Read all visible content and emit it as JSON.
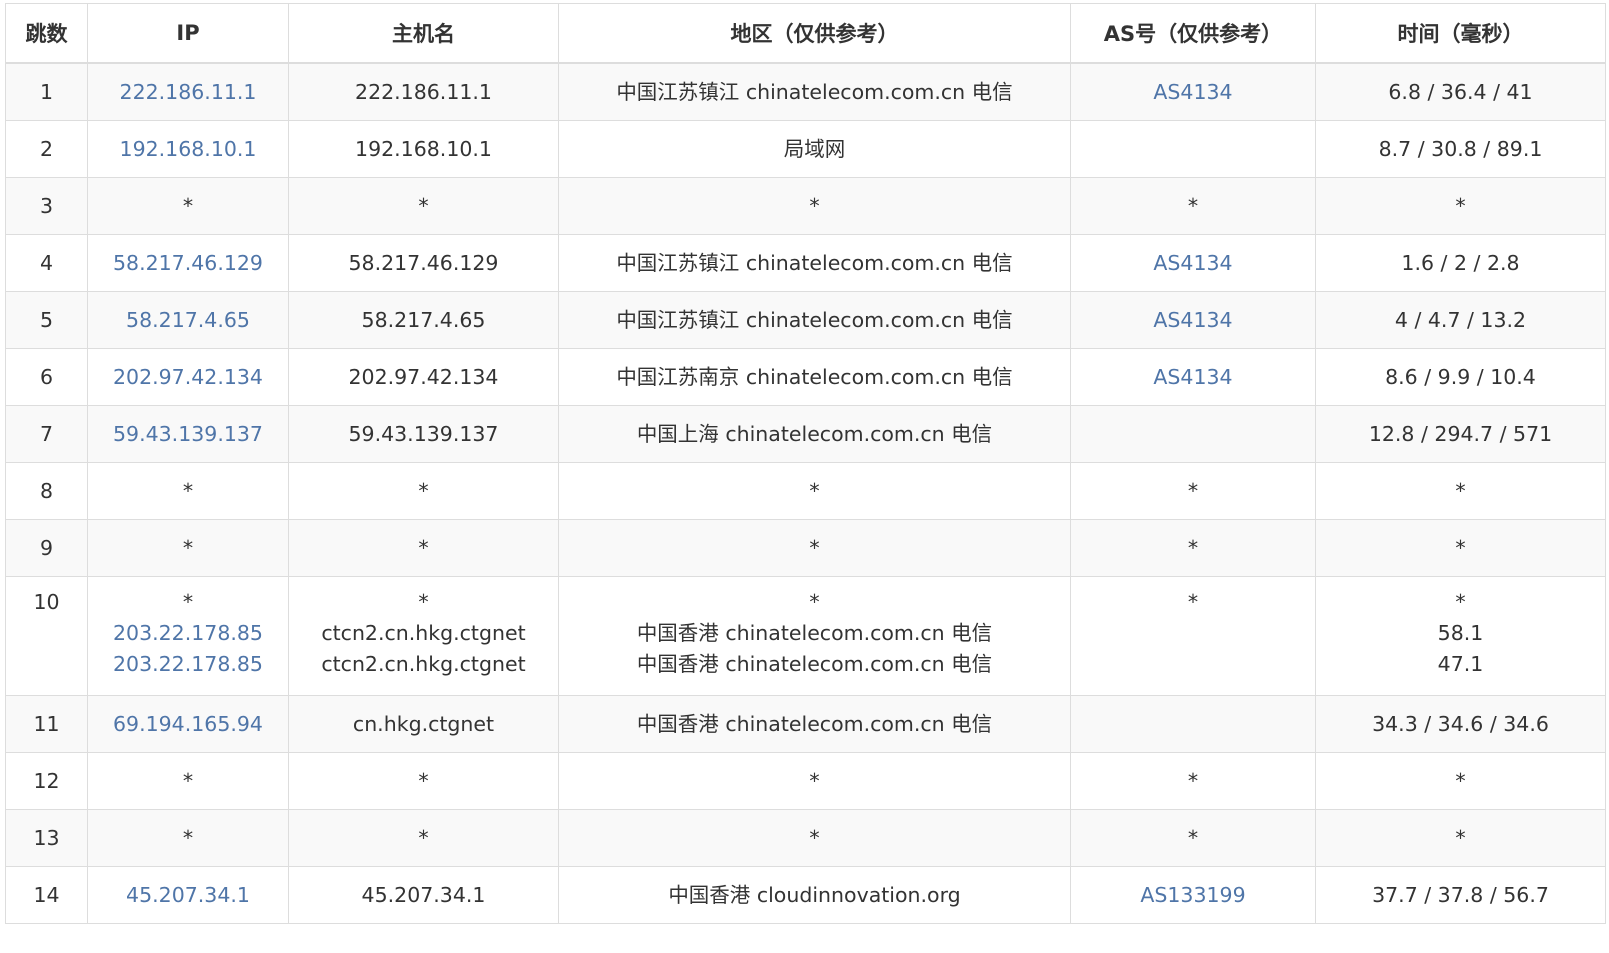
{
  "columns": [
    "跳数",
    "IP",
    "主机名",
    "地区（仅供参考）",
    "AS号（仅供参考）",
    "时间（毫秒）"
  ],
  "colors": {
    "link": "#4f75a8",
    "text": "#333333",
    "row_stripe": "#f9f9f9",
    "border": "#dddddd"
  },
  "rows": [
    {
      "hop": "1",
      "ip": [
        "222.186.11.1"
      ],
      "host": [
        "222.186.11.1"
      ],
      "region": [
        "中国江苏镇江 chinatelecom.com.cn 电信"
      ],
      "as": [
        "AS4134"
      ],
      "time": [
        "6.8 / 36.4 / 41"
      ]
    },
    {
      "hop": "2",
      "ip": [
        "192.168.10.1"
      ],
      "host": [
        "192.168.10.1"
      ],
      "region": [
        "局域网"
      ],
      "as": [
        ""
      ],
      "time": [
        "8.7 / 30.8 / 89.1"
      ]
    },
    {
      "hop": "3",
      "ip": [
        "*"
      ],
      "host": [
        "*"
      ],
      "region": [
        "*"
      ],
      "as": [
        "*"
      ],
      "time": [
        "*"
      ]
    },
    {
      "hop": "4",
      "ip": [
        "58.217.46.129"
      ],
      "host": [
        "58.217.46.129"
      ],
      "region": [
        "中国江苏镇江 chinatelecom.com.cn 电信"
      ],
      "as": [
        "AS4134"
      ],
      "time": [
        "1.6 / 2 / 2.8"
      ]
    },
    {
      "hop": "5",
      "ip": [
        "58.217.4.65"
      ],
      "host": [
        "58.217.4.65"
      ],
      "region": [
        "中国江苏镇江 chinatelecom.com.cn 电信"
      ],
      "as": [
        "AS4134"
      ],
      "time": [
        "4 / 4.7 / 13.2"
      ]
    },
    {
      "hop": "6",
      "ip": [
        "202.97.42.134"
      ],
      "host": [
        "202.97.42.134"
      ],
      "region": [
        "中国江苏南京 chinatelecom.com.cn 电信"
      ],
      "as": [
        "AS4134"
      ],
      "time": [
        "8.6 / 9.9 / 10.4"
      ]
    },
    {
      "hop": "7",
      "ip": [
        "59.43.139.137"
      ],
      "host": [
        "59.43.139.137"
      ],
      "region": [
        "中国上海 chinatelecom.com.cn 电信"
      ],
      "as": [
        ""
      ],
      "time": [
        "12.8 / 294.7 / 571"
      ]
    },
    {
      "hop": "8",
      "ip": [
        "*"
      ],
      "host": [
        "*"
      ],
      "region": [
        "*"
      ],
      "as": [
        "*"
      ],
      "time": [
        "*"
      ]
    },
    {
      "hop": "9",
      "ip": [
        "*"
      ],
      "host": [
        "*"
      ],
      "region": [
        "*"
      ],
      "as": [
        "*"
      ],
      "time": [
        "*"
      ]
    },
    {
      "hop": "10",
      "ip": [
        "*",
        "203.22.178.85",
        "203.22.178.85"
      ],
      "host": [
        "*",
        "ctcn2.cn.hkg.ctgnet",
        "ctcn2.cn.hkg.ctgnet"
      ],
      "region": [
        "*",
        "中国香港 chinatelecom.com.cn 电信",
        "中国香港 chinatelecom.com.cn 电信"
      ],
      "as": [
        "*"
      ],
      "time": [
        "*",
        "58.1",
        "47.1"
      ]
    },
    {
      "hop": "11",
      "ip": [
        "69.194.165.94"
      ],
      "host": [
        "cn.hkg.ctgnet"
      ],
      "region": [
        "中国香港 chinatelecom.com.cn 电信"
      ],
      "as": [
        ""
      ],
      "time": [
        "34.3 / 34.6 / 34.6"
      ]
    },
    {
      "hop": "12",
      "ip": [
        "*"
      ],
      "host": [
        "*"
      ],
      "region": [
        "*"
      ],
      "as": [
        "*"
      ],
      "time": [
        "*"
      ]
    },
    {
      "hop": "13",
      "ip": [
        "*"
      ],
      "host": [
        "*"
      ],
      "region": [
        "*"
      ],
      "as": [
        "*"
      ],
      "time": [
        "*"
      ]
    },
    {
      "hop": "14",
      "ip": [
        "45.207.34.1"
      ],
      "host": [
        "45.207.34.1"
      ],
      "region": [
        "中国香港 cloudinnovation.org"
      ],
      "as": [
        "AS133199"
      ],
      "time": [
        "37.7 / 37.8 / 56.7"
      ]
    }
  ]
}
